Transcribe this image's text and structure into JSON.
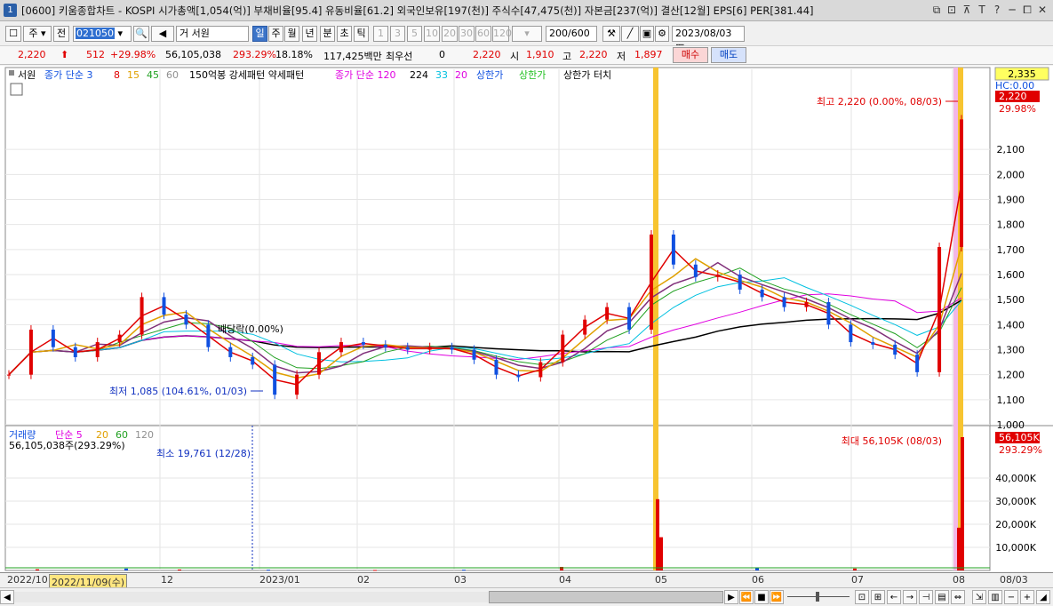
{
  "window": {
    "screen_no": "1",
    "title": "[0600] 키움종합차트 - KOSPI 시가총액[1,054(억)] 부채비율[95.4] 유동비율[61.2] 외국인보유[197(천)] 주식수[47,475(천)] 자본금[237(억)] 결산[12월] EPS[6] PER[381.44]",
    "buttons": [
      "⧉",
      "⊡",
      "⊼",
      "T",
      "?",
      "─",
      "⧠",
      "✕"
    ]
  },
  "toolbar": {
    "menu_icon": "☐",
    "type_label": "주",
    "prev_label": "전",
    "code": "021050",
    "search_icon": "🔍",
    "sound_icon": "◀",
    "name_prefix": "거",
    "stock_name": "서원",
    "periods": [
      "일",
      "주",
      "월",
      "년",
      "분",
      "초",
      "틱"
    ],
    "selected_period": "일",
    "intervals": [
      "1",
      "3",
      "5",
      "10",
      "20",
      "30",
      "60",
      "120"
    ],
    "count": "200",
    "total": "/600",
    "date": "2023/08/03"
  },
  "pricebar": {
    "price": "2,220",
    "arrow": "⬆",
    "change": "512",
    "change_pct": "+29.98%",
    "volume": "56,105,038",
    "vol_pct": "293.29%",
    "vol_pct2": "18.18%",
    "amount": "117,425백만",
    "pref_label": "최우선",
    "pref_val": "0",
    "cur": "2,220",
    "open_label": "시",
    "open": "1,910",
    "high_label": "고",
    "high": "2,220",
    "low_label": "저",
    "low": "1,897",
    "buy": "매수",
    "sell": "매도"
  },
  "legend": {
    "name": "서원",
    "ma_label": "종가 단순 3",
    "ma_periods": [
      "8",
      "15",
      "45",
      "60"
    ],
    "ma_colors": [
      "#e00000",
      "#e0a000",
      "#20a020",
      "#909090"
    ],
    "pattern_label": "150억봉 강세패턴 약세패턴",
    "ma2_label": "종가 단순 120",
    "ma2_periods": [
      "224",
      "33",
      "20"
    ],
    "ma2_colors": [
      "#000000",
      "#00c0e0",
      "#e000e0"
    ],
    "upper_label": "상한가",
    "upper2_label": "상한가",
    "touch_label": "상한가 터치"
  },
  "annotations": {
    "high": "최고 2,220 (0.00%, 08/03)",
    "low": "최저 1,085 (104.61%, 01/03)",
    "dividend": "배당락(0.00%)",
    "vol_max": "최대 56,105K (08/03)",
    "vol_min": "최소 19,761 (12/28)"
  },
  "price_axis": {
    "current_box": "2,335",
    "hc": "HC:0.00",
    "price_box": "2,220",
    "pct_box": "29.98%",
    "ticks": [
      "2,100",
      "2,000",
      "1,900",
      "1,800",
      "1,700",
      "1,600",
      "1,500",
      "1,400",
      "1,300",
      "1,200",
      "1,100",
      "1,000"
    ]
  },
  "volume_panel": {
    "label": "거래량",
    "ma_label": "단순 5",
    "ma_periods": [
      "20",
      "60",
      "120"
    ],
    "ma_colors": [
      "#e0a000",
      "#20a020",
      "#909090"
    ],
    "value": "56,105,038주(293.29%)",
    "value_box": "56,105K",
    "pct_box": "293.29%",
    "ticks": [
      "40,000K",
      "30,000K",
      "20,000K",
      "10,000K"
    ]
  },
  "xaxis": {
    "labels": [
      "2022/10",
      "12",
      "2023/01",
      "02",
      "03",
      "04",
      "05",
      "06",
      "07",
      "08",
      "08/03"
    ],
    "selected_date": "2022/11/09(수)"
  },
  "chart_data": {
    "type": "candlestick",
    "title": "서원",
    "ylim": [
      1000,
      2335
    ],
    "y_ticks": [
      1000,
      1100,
      1200,
      1300,
      1400,
      1500,
      1600,
      1700,
      1800,
      1900,
      2000,
      2100
    ],
    "close_series": [
      {
        "date": "2022/10",
        "close": 1200
      },
      {
        "date": "2022/10",
        "close": 1380
      },
      {
        "date": "2022/10",
        "close": 1310
      },
      {
        "date": "2022/11",
        "close": 1270
      },
      {
        "date": "2022/11",
        "close": 1330
      },
      {
        "date": "2022/11",
        "close": 1360
      },
      {
        "date": "2022/11",
        "close": 1510
      },
      {
        "date": "2022/11",
        "close": 1440
      },
      {
        "date": "2022/12",
        "close": 1400
      },
      {
        "date": "2022/12",
        "close": 1310
      },
      {
        "date": "2022/12",
        "close": 1270
      },
      {
        "date": "2022/12",
        "close": 1240
      },
      {
        "date": "2023/01",
        "close": 1120
      },
      {
        "date": "2023/01",
        "close": 1200
      },
      {
        "date": "2023/01",
        "close": 1290
      },
      {
        "date": "2023/01",
        "close": 1330
      },
      {
        "date": "2023/02",
        "close": 1320
      },
      {
        "date": "2023/02",
        "close": 1310
      },
      {
        "date": "2023/02",
        "close": 1300
      },
      {
        "date": "2023/02",
        "close": 1310
      },
      {
        "date": "2023/03",
        "close": 1300
      },
      {
        "date": "2023/03",
        "close": 1260
      },
      {
        "date": "2023/03",
        "close": 1200
      },
      {
        "date": "2023/03",
        "close": 1190
      },
      {
        "date": "2023/04",
        "close": 1250
      },
      {
        "date": "2023/04",
        "close": 1360
      },
      {
        "date": "2023/04",
        "close": 1420
      },
      {
        "date": "2023/04",
        "close": 1470
      },
      {
        "date": "2023/04",
        "close": 1380
      },
      {
        "date": "2023/05",
        "close": 1760
      },
      {
        "date": "2023/05",
        "close": 1640
      },
      {
        "date": "2023/05",
        "close": 1590
      },
      {
        "date": "2023/05",
        "close": 1600
      },
      {
        "date": "2023/06",
        "close": 1540
      },
      {
        "date": "2023/06",
        "close": 1510
      },
      {
        "date": "2023/06",
        "close": 1470
      },
      {
        "date": "2023/06",
        "close": 1490
      },
      {
        "date": "2023/07",
        "close": 1400
      },
      {
        "date": "2023/07",
        "close": 1330
      },
      {
        "date": "2023/07",
        "close": 1320
      },
      {
        "date": "2023/07",
        "close": 1280
      },
      {
        "date": "2023/08",
        "close": 1210
      },
      {
        "date": "2023/08",
        "close": 1710
      },
      {
        "date": "2023/08/03",
        "close": 2220
      }
    ],
    "volume_k": [
      {
        "date": "2022/10",
        "volume": 500
      },
      {
        "date": "2022/11",
        "volume": 800
      },
      {
        "date": "2022/12",
        "volume": 400
      },
      {
        "date": "2023/01",
        "volume": 300
      },
      {
        "date": "2023/02",
        "volume": 200
      },
      {
        "date": "2023/03",
        "volume": 300
      },
      {
        "date": "2023/04",
        "volume": 1500
      },
      {
        "date": "2023/05",
        "volume": 30000
      },
      {
        "date": "2023/05",
        "volume": 14000
      },
      {
        "date": "2023/06",
        "volume": 1200
      },
      {
        "date": "2023/07",
        "volume": 800
      },
      {
        "date": "2023/08",
        "volume": 18000
      },
      {
        "date": "2023/08/03",
        "volume": 56105
      }
    ]
  }
}
